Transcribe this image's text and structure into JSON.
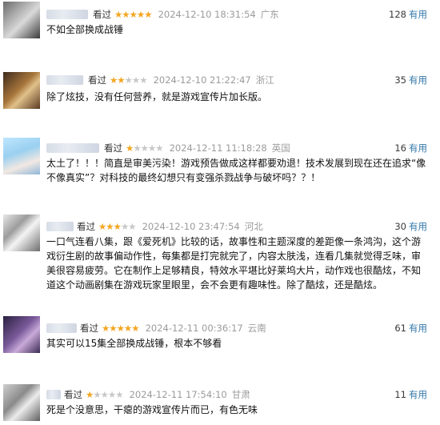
{
  "colors": {
    "star": "#f4a623",
    "star_empty": "#c8c8c8",
    "link": "#3377aa",
    "meta": "#9b9b9b"
  },
  "comments": [
    {
      "kind": "看过",
      "rating": 5,
      "time": "2024-12-10 18:31:54",
      "location": "广东",
      "votes": "128",
      "votes_label": "有用",
      "content": "不如全部换成战锤"
    },
    {
      "kind": "看过",
      "rating": 2,
      "time": "2024-12-10 21:22:47",
      "location": "浙江",
      "votes": "35",
      "votes_label": "有用",
      "content": "除了炫技，没有任何营养，就是游戏宣传片加长版。"
    },
    {
      "kind": "看过",
      "rating": 1,
      "time": "2024-12-11 11:18:28",
      "location": "英国",
      "votes": "16",
      "votes_label": "有用",
      "content": "太土了！！！简直是审美污染！游戏预告做成这样都要劝退！技术发展到现在还在追求“像不像真实”？对科技的最终幻想只有变强杀戮战争与破坏吗？？！"
    },
    {
      "kind": "看过",
      "rating": 3,
      "time": "2024-12-10 23:47:54",
      "location": "河北",
      "votes": "30",
      "votes_label": "有用",
      "content": "一口气连看八集，跟《爱死机》比较的话，故事性和主题深度的差距像一条鸿沟，这个游戏衍生剧的故事偏动作性，每集都是打完就完了，内容太肤浅，连看几集就觉得乏味，审美很容易疲劳。它在制作上足够精良，特效水平堪比好莱坞大片，动作戏也很酷炫，不知道这个动画剧集在游戏玩家里眼里，会不会更有趣味性。除了酷炫，还是酷炫。"
    },
    {
      "kind": "看过",
      "rating": 5,
      "time": "2024-12-11 00:36:17",
      "location": "云南",
      "votes": "61",
      "votes_label": "有用",
      "content": "其实可以15集全部换成战锤，根本不够看"
    },
    {
      "kind": "看过",
      "rating": 1,
      "time": "2024-12-11 17:54:10",
      "location": "甘肃",
      "votes": "11",
      "votes_label": "有用",
      "content": "死是个没意思，干瘪的游戏宣传片而已，有色无味"
    }
  ]
}
